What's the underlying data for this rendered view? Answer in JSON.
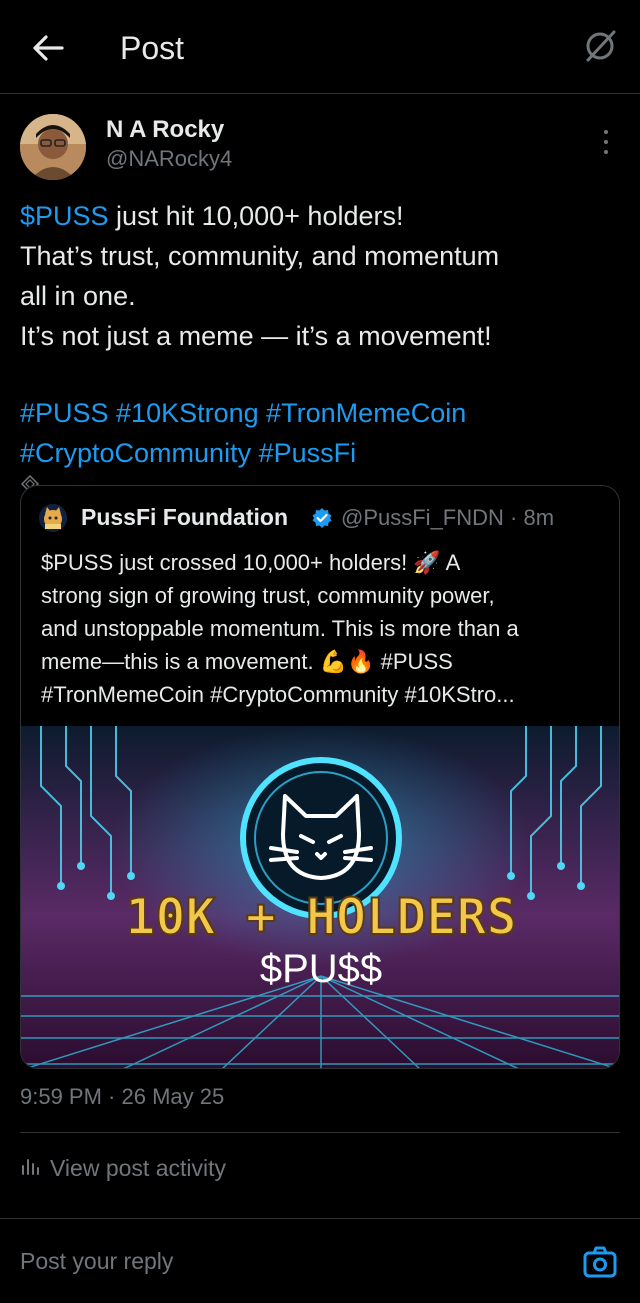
{
  "header": {
    "title": "Post"
  },
  "author": {
    "name": "N A Rocky",
    "handle": "@NARocky4"
  },
  "post": {
    "line1_mention": "$PUSS",
    "line1_rest": " just hit 10,000+ holders!",
    "line2": "That’s trust, community, and momentum",
    "line3": "all in one.",
    "line4": "It’s not just a meme — it’s a movement!",
    "tags_line1": "#PUSS #10KStrong #TronMemeCoin",
    "tags_line2": "#CryptoCommunity #PussFi",
    "timestamp": "9:59 PM · 26 May 25"
  },
  "quote": {
    "name": "PussFi Foundation",
    "handle": "@PussFi_FNDN · 8m",
    "lines": [
      "$PUSS just crossed 10,000+ holders! 🚀 A",
      "strong sign of growing trust, community power,",
      "and unstoppable momentum. This is more than a",
      "meme—this is a movement. 💪🔥 #PUSS",
      "#TronMemeCoin #CryptoCommunity #10KStro..."
    ],
    "image_headline": "10K + HOLDERS",
    "image_ticker": "$PU$$"
  },
  "activity": {
    "label": "View post activity"
  },
  "reply": {
    "placeholder": "Post your reply"
  },
  "colors": {
    "background": "#000000",
    "text": "#e7e9ea",
    "muted": "#71767b",
    "link": "#1d9bf0",
    "divider": "#2f3336"
  },
  "icons": [
    "back-arrow-icon",
    "grok-icon",
    "more-vertical-icon",
    "diamond-icon",
    "verified-badge-icon",
    "bar-chart-icon",
    "camera-icon"
  ]
}
